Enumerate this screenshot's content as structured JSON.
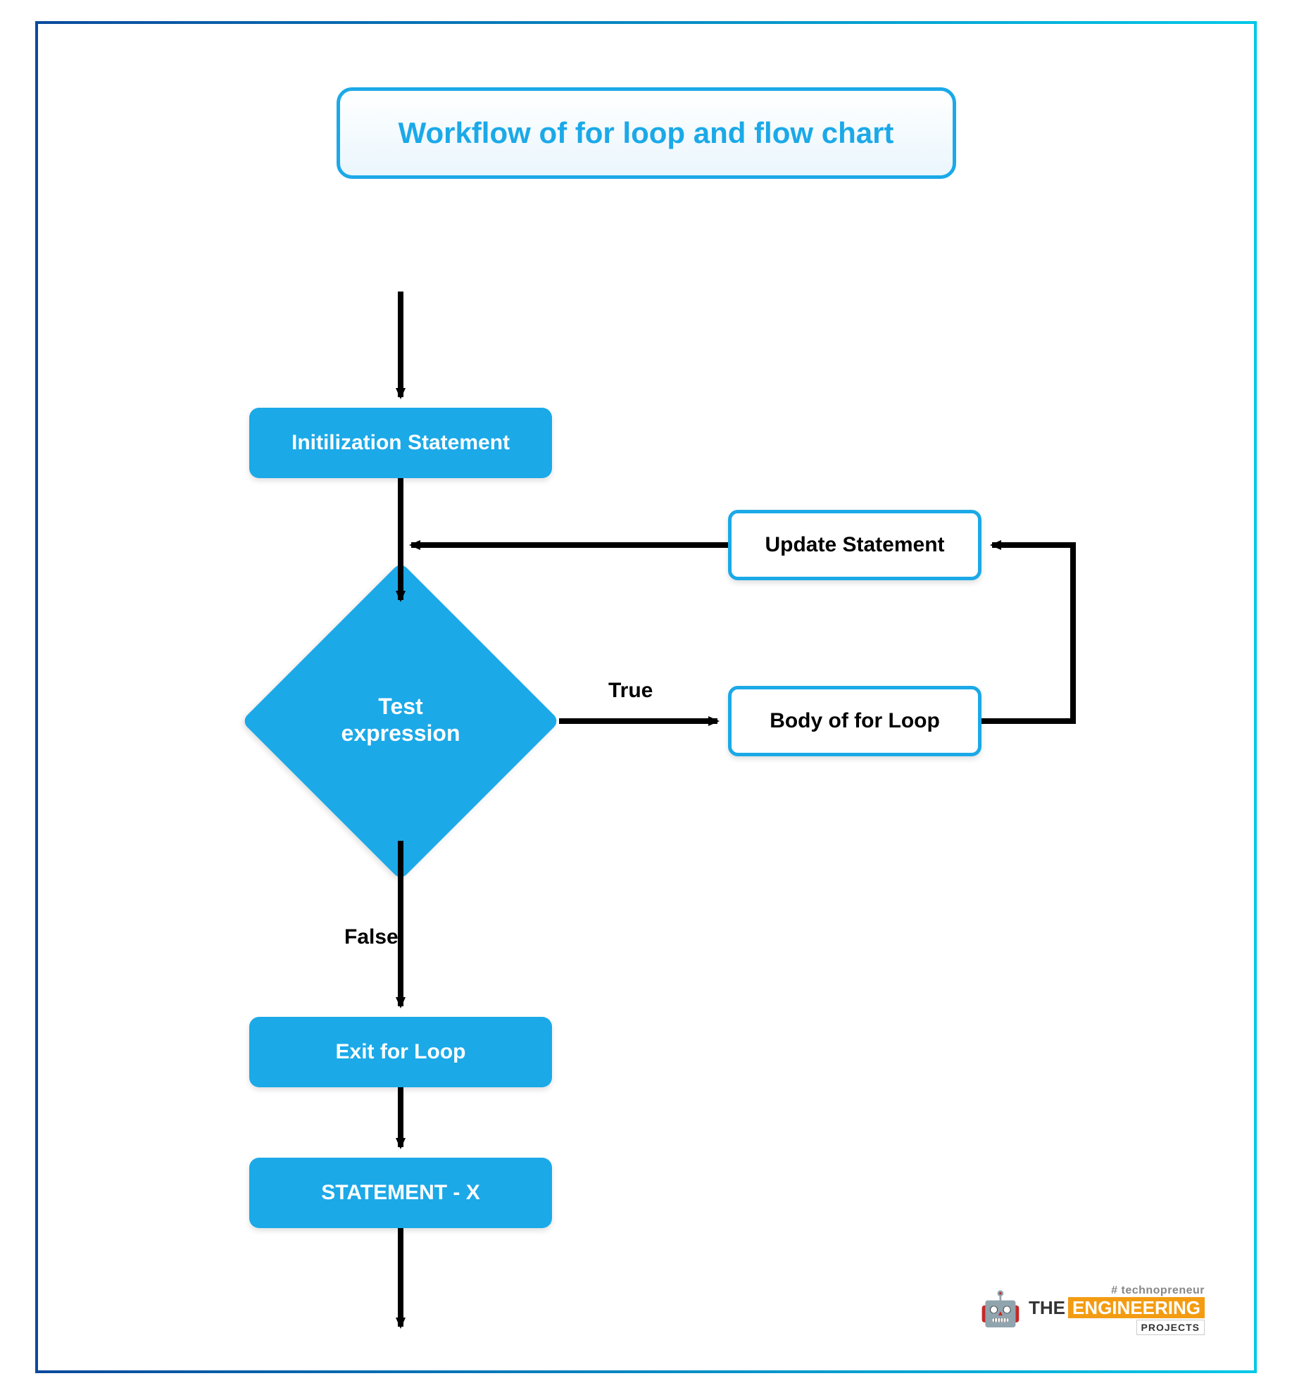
{
  "title": "Workflow of for loop and flow chart",
  "nodes": {
    "init": "Initilization Statement",
    "update": "Update Statement",
    "test": "Test expression",
    "body": "Body of for Loop",
    "exit": "Exit for Loop",
    "stmtx": "STATEMENT - X"
  },
  "edges": {
    "true": "True",
    "false": "False"
  },
  "logo": {
    "tag": "# technopreneur",
    "the": "THE",
    "eng": "ENGINEERING",
    "proj": "PROJECTS"
  }
}
